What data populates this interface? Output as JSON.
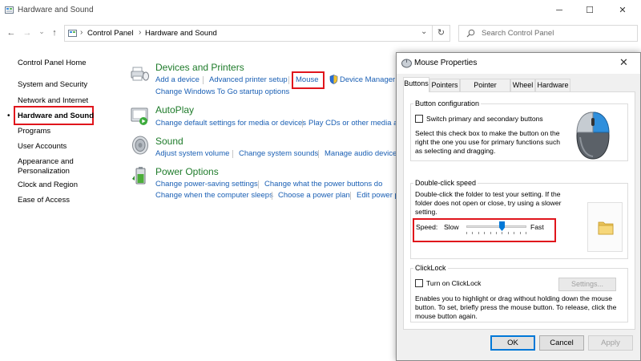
{
  "window": {
    "title": "Hardware and Sound",
    "minimize_glyph": "─",
    "maximize_glyph": "☐",
    "close_glyph": "✕"
  },
  "nav": {
    "back_glyph": "←",
    "forward_glyph": "→",
    "dropdown_glyph": "⌄",
    "up_glyph": "↑",
    "breadcrumb": [
      "Control Panel",
      "Hardware and Sound"
    ],
    "crumb_sep": "›",
    "address_dropdown_glyph": "⌄",
    "refresh_glyph": "↻",
    "search_placeholder": "Search Control Panel"
  },
  "sidebar": {
    "items": [
      {
        "label": "Control Panel Home"
      },
      {
        "label": "System and Security"
      },
      {
        "label": "Network and Internet"
      },
      {
        "label": "Hardware and Sound",
        "selected": true
      },
      {
        "label": "Programs"
      },
      {
        "label": "User Accounts"
      },
      {
        "label": "Appearance and"
      },
      {
        "label": "Personalization"
      },
      {
        "label": "Clock and Region"
      },
      {
        "label": "Ease of Access"
      }
    ]
  },
  "categories": {
    "devices": {
      "title": "Devices and Printers",
      "links": [
        "Add a device",
        "Advanced printer setup",
        "Mouse",
        "Device Manager"
      ],
      "links2": [
        "Change Windows To Go startup options"
      ]
    },
    "autoplay": {
      "title": "AutoPlay",
      "links": [
        "Change default settings for media or devices",
        "Play CDs or other media auto"
      ]
    },
    "sound": {
      "title": "Sound",
      "links": [
        "Adjust system volume",
        "Change system sounds",
        "Manage audio devices"
      ]
    },
    "power": {
      "title": "Power Options",
      "links": [
        "Change power-saving settings",
        "Change what the power buttons do"
      ],
      "links2": [
        "Change when the computer sleeps",
        "Choose a power plan",
        "Edit power p"
      ]
    }
  },
  "dialog": {
    "title": "Mouse Properties",
    "close_glyph": "✕",
    "tabs": [
      "Buttons",
      "Pointers",
      "Pointer Options",
      "Wheel",
      "Hardware"
    ],
    "active_tab": "Buttons",
    "button_config": {
      "group_title": "Button configuration",
      "checkbox_label": "Switch primary and secondary buttons",
      "checked": false,
      "description_lines": [
        "Select this check box to make the button on the",
        "right the one you use for primary functions such",
        "as selecting and dragging."
      ]
    },
    "double_click": {
      "group_title": "Double-click speed",
      "description_lines": [
        "Double-click the folder to test your setting. If the",
        "folder does not open or close, try using a slower",
        "setting."
      ],
      "speed_label": "Speed:",
      "slow_label": "Slow",
      "fast_label": "Fast",
      "speed_value": 0.6
    },
    "clicklock": {
      "group_title": "ClickLock",
      "checkbox_label": "Turn on ClickLock",
      "checked": false,
      "settings_button": "Settings...",
      "description_lines": [
        "Enables you to highlight or drag without holding down the mouse",
        "button. To set, briefly press the mouse button. To release, click the",
        "mouse button again."
      ]
    },
    "buttons": {
      "ok": "OK",
      "cancel": "Cancel",
      "apply": "Apply"
    }
  },
  "colors": {
    "highlight_red": "#e0151c",
    "link_blue": "#1a5fb4",
    "category_green": "#1e7b2a",
    "accent_blue": "#0078d7"
  }
}
